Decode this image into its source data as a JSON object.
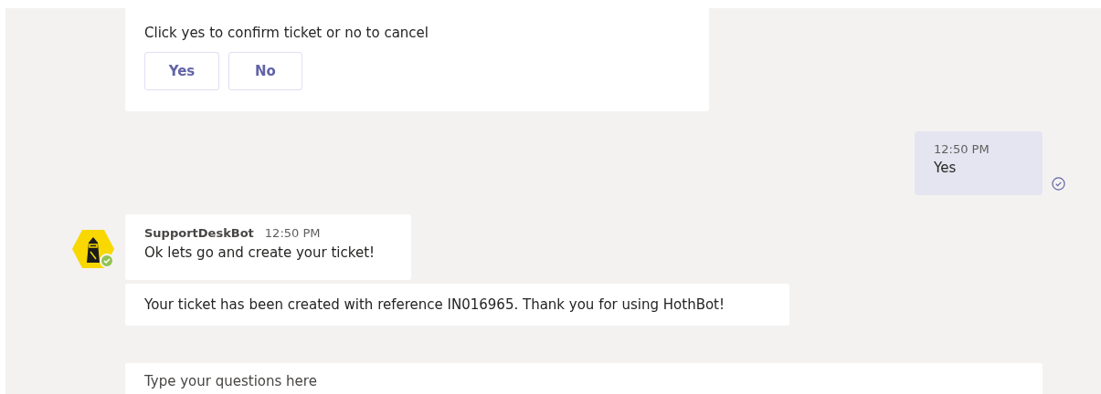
{
  "confirm_card": {
    "prompt": "Click yes to confirm ticket or no to cancel",
    "buttons": [
      "Yes",
      "No"
    ]
  },
  "sent_message": {
    "time": "12:50 PM",
    "text": "Yes"
  },
  "bot_messages": {
    "sender": "SupportDeskBot",
    "time": "12:50 PM",
    "texts": [
      "Ok lets go and create your ticket!",
      "Your ticket has been created with reference IN016965. Thank you for using HothBot!"
    ]
  },
  "composer": {
    "placeholder": "Type your questions here"
  }
}
